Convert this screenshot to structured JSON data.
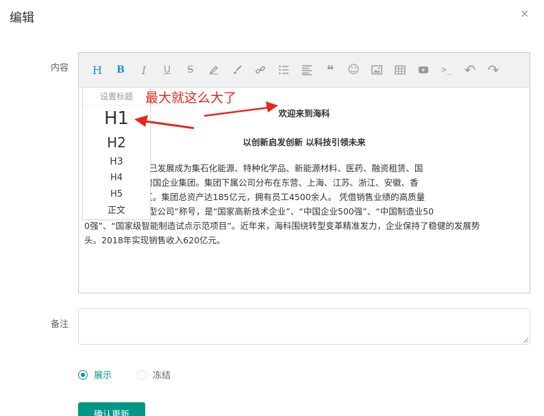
{
  "dialog": {
    "title": "编辑",
    "close_glyph": "×"
  },
  "form": {
    "content_label": "内容",
    "remark_label": "备注",
    "remark_value": "",
    "status_options": [
      {
        "label": "展示",
        "selected": true
      },
      {
        "label": "冻结",
        "selected": false
      }
    ],
    "submit_label": "确认更新"
  },
  "toolbar": {
    "buttons": [
      "heading-icon",
      "bold-icon",
      "italic-icon",
      "underline-icon",
      "strikethrough-icon",
      "font-color-icon",
      "background-color-icon",
      "link-icon",
      "list-icon",
      "justify-icon",
      "quote-icon",
      "emoticon-icon",
      "image-icon",
      "table-icon",
      "video-icon",
      "code-icon",
      "undo-icon",
      "redo-icon"
    ],
    "heading_glyph": "H",
    "bold_glyph": "B",
    "italic_glyph": "I",
    "underline_glyph": "U",
    "strike_glyph": "S",
    "quote_glyph": "❝",
    "emoticon_glyph": "☺",
    "code_glyph": ">_",
    "undo_glyph": "↶",
    "redo_glyph": "↷"
  },
  "editor": {
    "title1": "欢迎来到海科",
    "title2": "以创新启发创新 以科技引领未来",
    "paragraph_lines": [
      "           于1988年，目前已发展成为集石化能源、特种化学品、新能源材料、医药、融资租赁、国",
      "           大的综合性大型跨国企业集团。集团下属公司分布在东营、上海、江苏、浙江、安徽、香",
      "           加坡等国家和地区。集团总资产达185亿元，拥有员工4500余人。 凭借销售业绩的高质量",
      "           济论坛“全球成长型公司”称号，是“国家高新技术企业”、“中国企业500强”、“中国制造业50",
      "0强”、“国家级智能制造试点示范项目”。近年来，海科围绕转型变革精准发力，企业保持了稳健的发展势",
      "头。2018年实现销售收入620亿元。"
    ]
  },
  "heading_menu": {
    "header": "设置标题",
    "items": [
      "H1",
      "H2",
      "H3",
      "H4",
      "H5",
      "正文"
    ]
  },
  "annotation": {
    "text": "最大就这么大了",
    "color": "#e8261c"
  },
  "colors": {
    "accent": "#009688",
    "toolbar_active": "#1e88e5"
  }
}
